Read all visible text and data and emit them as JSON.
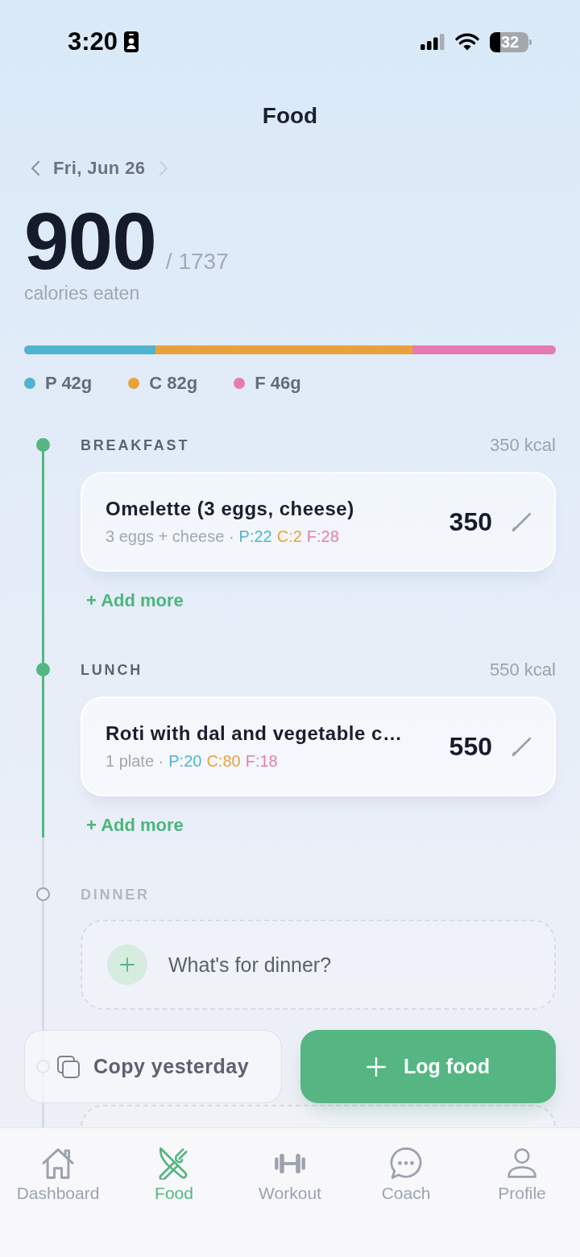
{
  "status_bar": {
    "time": "3:20",
    "battery": "32"
  },
  "header": {
    "title": "Food"
  },
  "date_nav": {
    "date": "Fri, Jun 26",
    "next_disabled": true
  },
  "summary": {
    "eaten": "900",
    "goal": "/ 1737",
    "caption": "calories eaten"
  },
  "macros": [
    {
      "label": "P 42g",
      "color": "#4fb3d1",
      "level": 0.247
    },
    {
      "label": "C 82g",
      "color": "#e9a23b",
      "level": 0.483
    },
    {
      "label": "F 46g",
      "color": "#e67bb3",
      "level": 0.27
    }
  ],
  "meals": [
    {
      "name": "BREAKFAST",
      "total": "350 kcal",
      "logged": true,
      "entries": [
        {
          "name": "Omelette (3 eggs, cheese)",
          "portion": "3 eggs + cheese ·",
          "macros": [
            {
              "text": "P:22",
              "color": "#4fb3d1"
            },
            {
              "text": "C:2",
              "color": "#e9a23b"
            },
            {
              "text": "F:28",
              "color": "#e67bb3"
            }
          ],
          "calories": "350"
        }
      ],
      "add_more": "+ Add more"
    },
    {
      "name": "LUNCH",
      "total": "550 kcal",
      "logged": true,
      "entries": [
        {
          "name": "Roti with dal and vegetable c…",
          "portion": "1 plate ·",
          "macros": [
            {
              "text": "P:20",
              "color": "#4fb3d1"
            },
            {
              "text": "C:80",
              "color": "#e9a23b"
            },
            {
              "text": "F:18",
              "color": "#e67bb3"
            }
          ],
          "calories": "550"
        }
      ],
      "add_more": "+ Add more"
    },
    {
      "name": "DINNER",
      "logged": false,
      "prompt": "What's for dinner?"
    },
    {
      "logged": false
    }
  ],
  "actions": [
    {
      "kind": "secondary",
      "label": "Copy yesterday"
    },
    {
      "kind": "primary",
      "label": "Log food"
    }
  ],
  "tab_bar": [
    {
      "label": "Dashboard",
      "selected": false
    },
    {
      "label": "Food",
      "selected": true
    },
    {
      "label": "Workout",
      "selected": false
    },
    {
      "label": "Coach",
      "selected": false
    },
    {
      "label": "Profile",
      "selected": false
    }
  ]
}
